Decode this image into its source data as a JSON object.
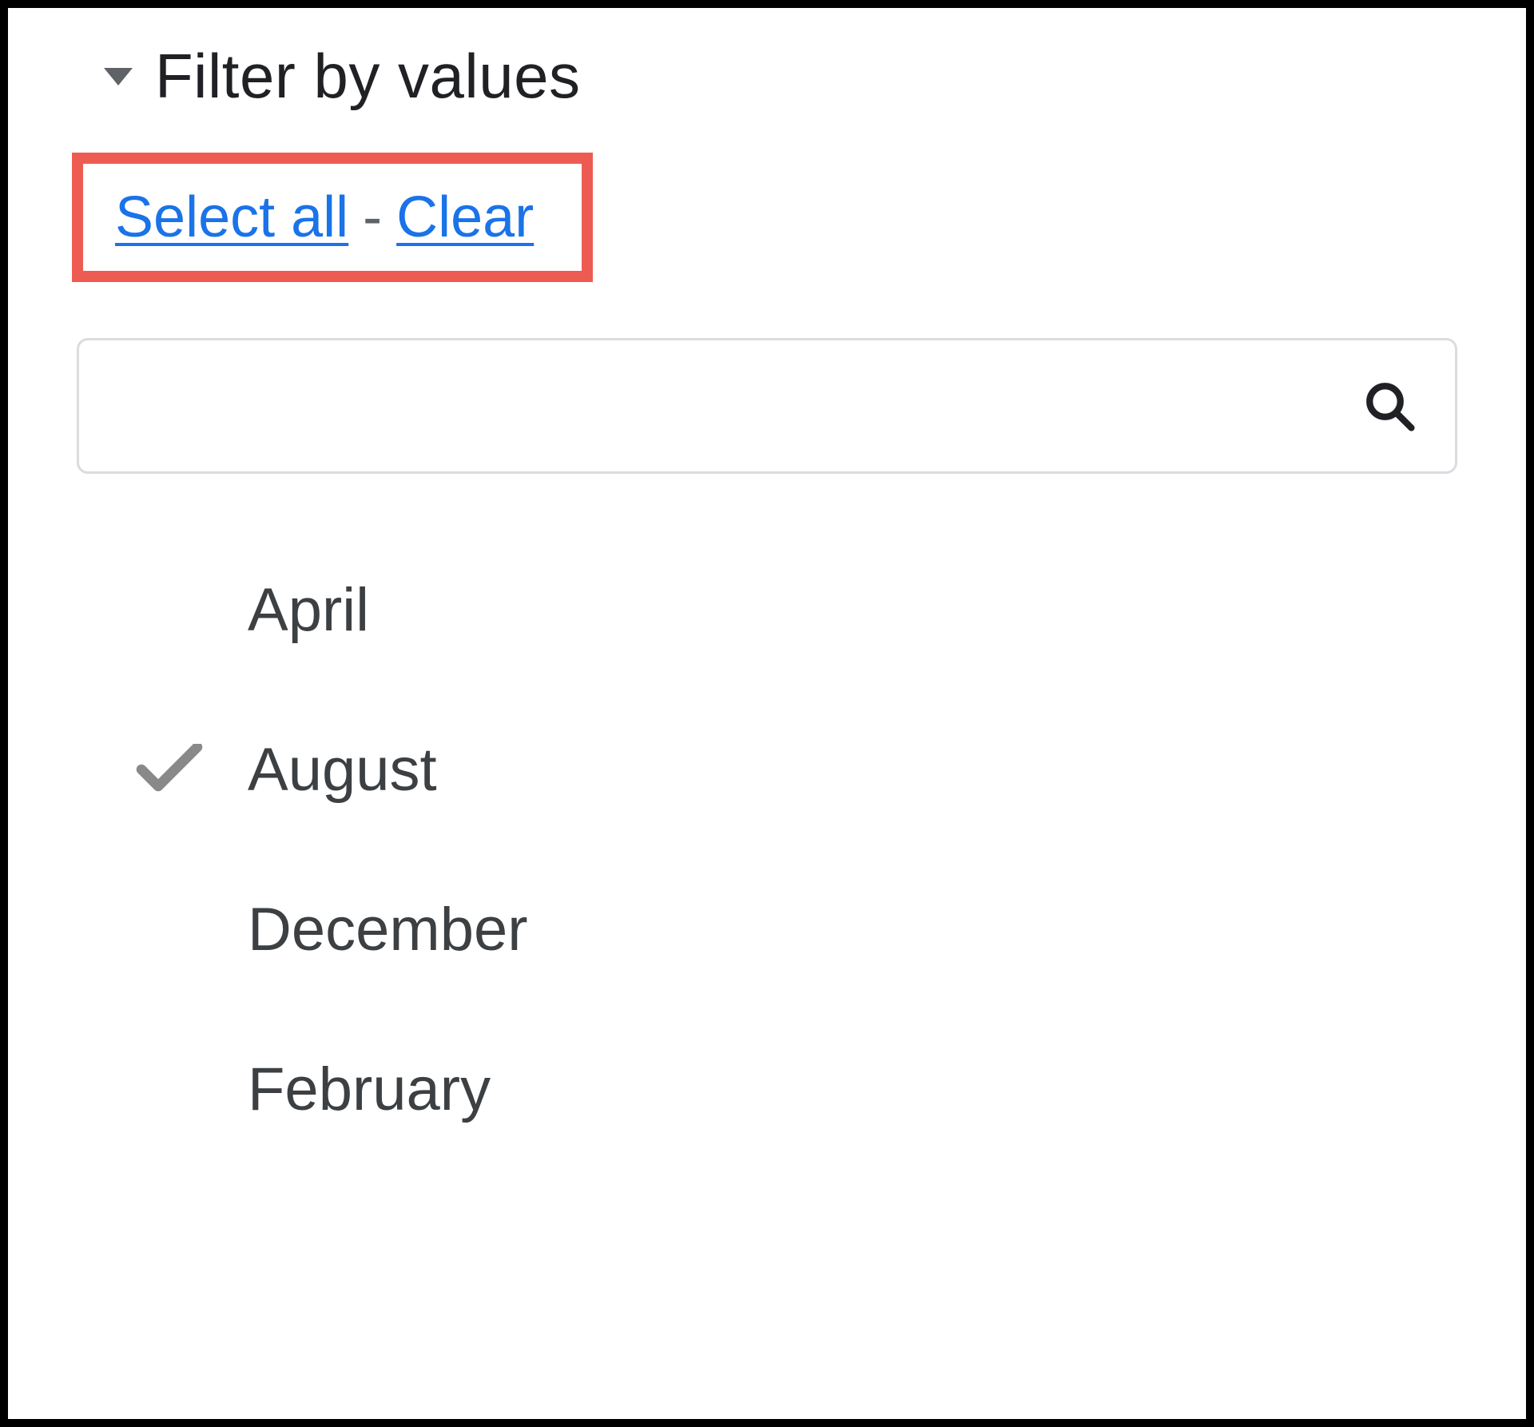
{
  "header": {
    "title": "Filter by values"
  },
  "actions": {
    "select_all": "Select all",
    "separator": "-",
    "clear": "Clear"
  },
  "search": {
    "value": "",
    "placeholder": ""
  },
  "items": [
    {
      "label": "April",
      "checked": false
    },
    {
      "label": "August",
      "checked": true
    },
    {
      "label": "December",
      "checked": false
    },
    {
      "label": "February",
      "checked": false
    }
  ]
}
